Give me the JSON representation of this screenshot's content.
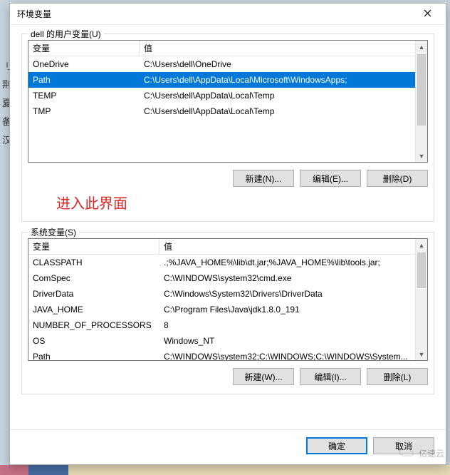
{
  "window": {
    "title": "环境变量"
  },
  "user_section": {
    "legend": "dell 的用户变量(U)",
    "headers": {
      "name": "变量",
      "value": "值"
    },
    "rows": [
      {
        "name": "OneDrive",
        "value": "C:\\Users\\dell\\OneDrive",
        "selected": false
      },
      {
        "name": "Path",
        "value": "C:\\Users\\dell\\AppData\\Local\\Microsoft\\WindowsApps;",
        "selected": true
      },
      {
        "name": "TEMP",
        "value": "C:\\Users\\dell\\AppData\\Local\\Temp",
        "selected": false
      },
      {
        "name": "TMP",
        "value": "C:\\Users\\dell\\AppData\\Local\\Temp",
        "selected": false
      }
    ],
    "buttons": {
      "new": "新建(N)...",
      "edit": "编辑(E)...",
      "delete": "删除(D)"
    }
  },
  "annotation": "进入此界面",
  "system_section": {
    "legend": "系统变量(S)",
    "headers": {
      "name": "变量",
      "value": "值"
    },
    "rows": [
      {
        "name": "CLASSPATH",
        "value": ".;%JAVA_HOME%\\lib\\dt.jar;%JAVA_HOME%\\lib\\tools.jar;"
      },
      {
        "name": "ComSpec",
        "value": "C:\\WINDOWS\\system32\\cmd.exe"
      },
      {
        "name": "DriverData",
        "value": "C:\\Windows\\System32\\Drivers\\DriverData"
      },
      {
        "name": "JAVA_HOME",
        "value": "C:\\Program Files\\Java\\jdk1.8.0_191"
      },
      {
        "name": "NUMBER_OF_PROCESSORS",
        "value": "8"
      },
      {
        "name": "OS",
        "value": "Windows_NT"
      },
      {
        "name": "Path",
        "value": "C:\\WINDOWS\\system32;C:\\WINDOWS;C:\\WINDOWS\\System..."
      }
    ],
    "buttons": {
      "new": "新建(W)...",
      "edit": "编辑(I)...",
      "delete": "删除(L)"
    }
  },
  "footer": {
    "ok": "确定",
    "cancel": "取消"
  },
  "side_letters": [
    "刂",
    "荆",
    "夏",
    "备",
    "汉"
  ],
  "watermark": "亿速云"
}
